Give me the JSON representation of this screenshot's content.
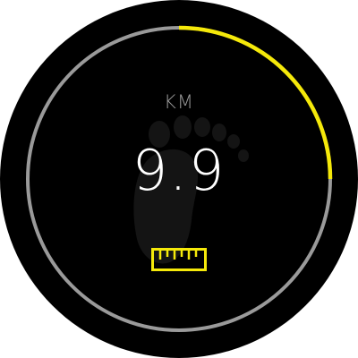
{
  "watch": {
    "unit": "KM",
    "distance": "9.9",
    "goal_progress": 0.25
  },
  "icons": {
    "background": "footprint-icon",
    "metric": "ruler-icon"
  },
  "colors": {
    "background": "#000000",
    "track": "#9a9a9a",
    "progress": "#f5e90a",
    "value_text": "#ffffff",
    "unit_text": "#9a9a9a",
    "footprint": "#141414",
    "ruler": "#f5e90a"
  }
}
